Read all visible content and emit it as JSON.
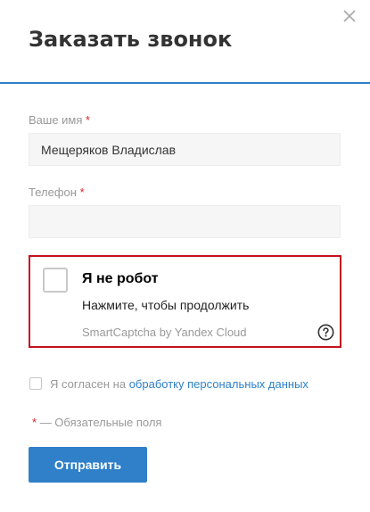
{
  "dialog": {
    "title": "Заказать звонок",
    "close_icon": "close-icon"
  },
  "form": {
    "name": {
      "label": "Ваше имя",
      "required_mark": "*",
      "value": "Мещеряков Владислав"
    },
    "phone": {
      "label": "Телефон",
      "required_mark": "*",
      "value": ""
    },
    "captcha": {
      "title": "Я не робот",
      "subtitle": "Нажмите, чтобы продолжить",
      "brand": "SmartCaptcha by Yandex Cloud",
      "help_icon": "question-circle-icon"
    },
    "consent": {
      "text_prefix": "Я согласен на",
      "link_text": "обработку персональных данных",
      "checked": false
    },
    "required_note": {
      "mark": "*",
      "text": "— Обязательные поля"
    },
    "submit_label": "Отправить"
  },
  "colors": {
    "accent": "#2f80c9",
    "required": "#d6262b",
    "captcha_border": "#c4121f"
  }
}
